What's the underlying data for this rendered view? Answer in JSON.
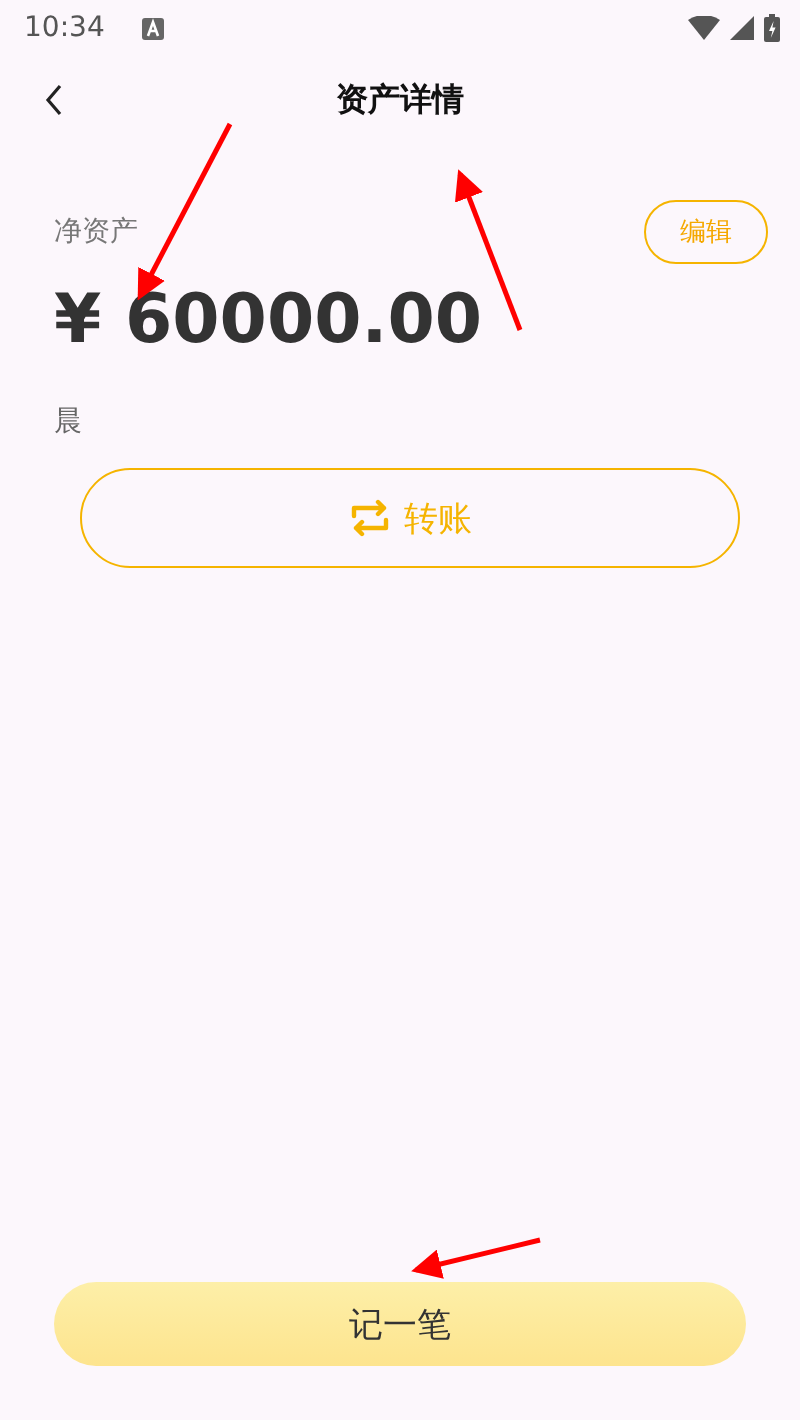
{
  "status_bar": {
    "time": "10:34"
  },
  "header": {
    "title": "资产详情"
  },
  "asset": {
    "label": "净资产",
    "edit_button": "编辑",
    "amount": "¥ 60000.00",
    "account_name": "晨"
  },
  "transfer_button": {
    "label": "转账"
  },
  "record_button": {
    "label": "记一笔"
  }
}
